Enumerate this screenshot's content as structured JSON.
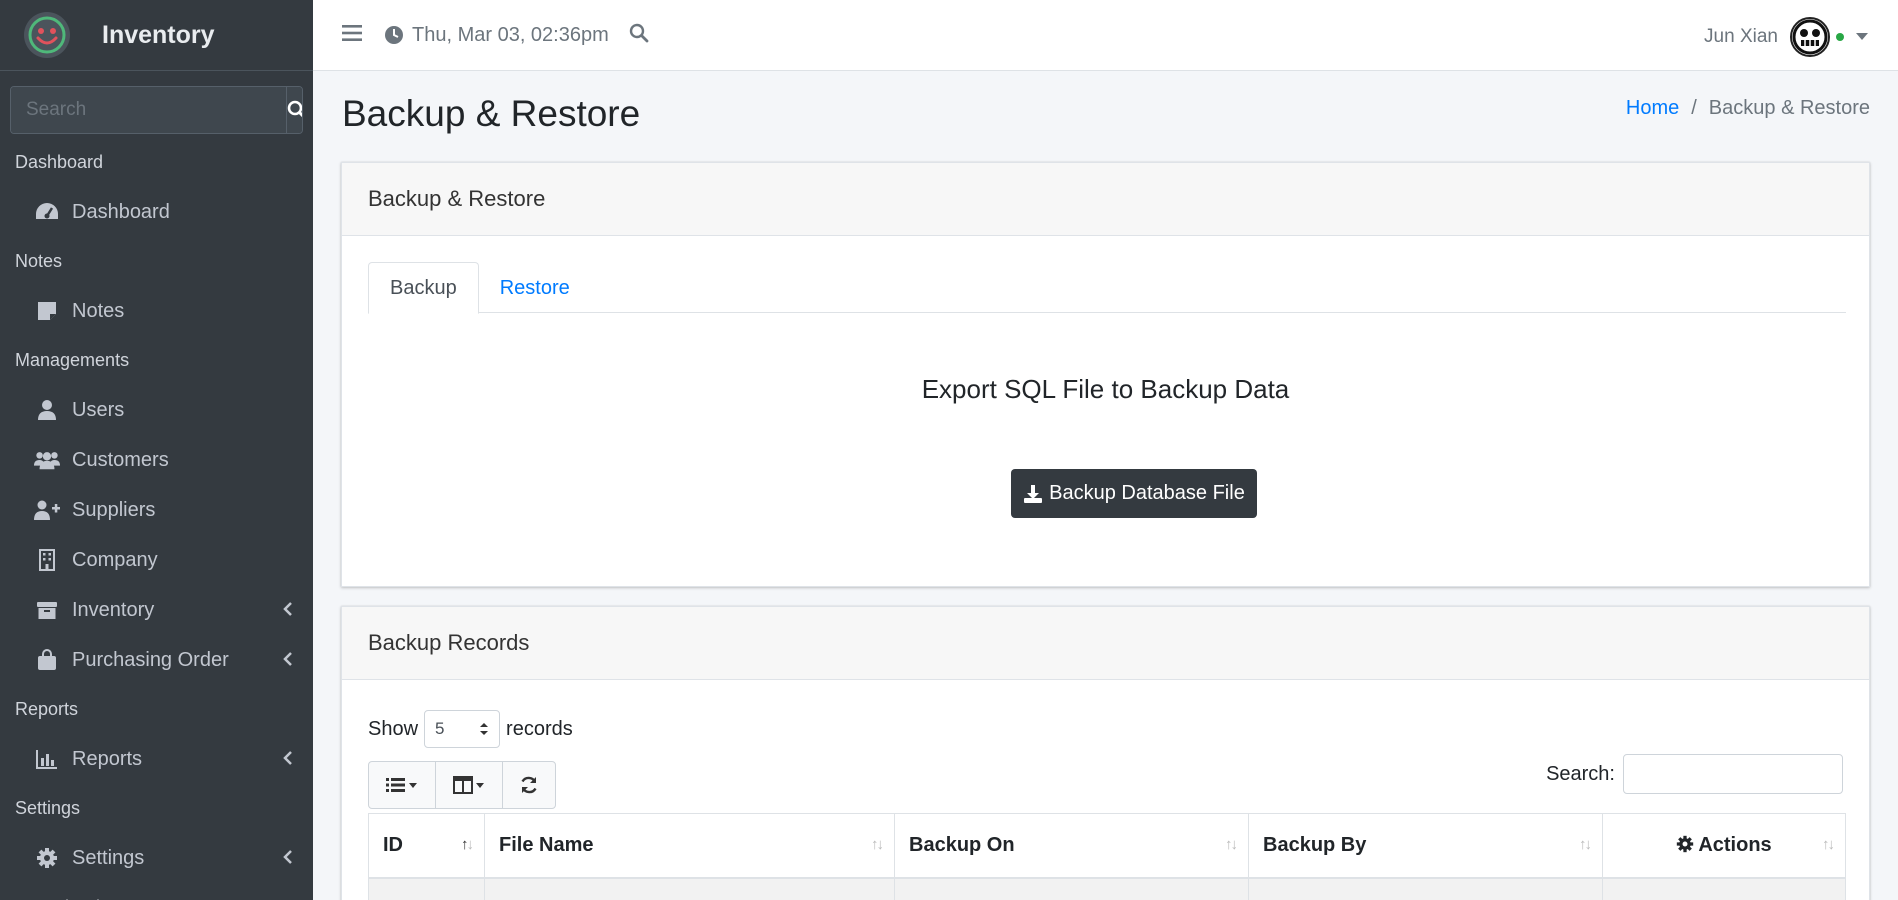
{
  "brand": {
    "name": "Inventory"
  },
  "sidebar": {
    "search_placeholder": "Search",
    "sections": [
      {
        "header": "Dashboard",
        "items": [
          {
            "label": "Dashboard",
            "icon": "tachometer-icon"
          }
        ]
      },
      {
        "header": "Notes",
        "items": [
          {
            "label": "Notes",
            "icon": "sticky-note-icon"
          }
        ]
      },
      {
        "header": "Managements",
        "items": [
          {
            "label": "Users",
            "icon": "user-icon"
          },
          {
            "label": "Customers",
            "icon": "users-icon"
          },
          {
            "label": "Suppliers",
            "icon": "user-plus-icon"
          },
          {
            "label": "Company",
            "icon": "building-icon"
          },
          {
            "label": "Inventory",
            "icon": "box-icon",
            "expandable": true
          },
          {
            "label": "Purchasing Order",
            "icon": "shopping-bag-icon",
            "expandable": true
          }
        ]
      },
      {
        "header": "Reports",
        "items": [
          {
            "label": "Reports",
            "icon": "chart-bar-icon",
            "expandable": true
          }
        ]
      },
      {
        "header": "Settings",
        "items": [
          {
            "label": "Settings",
            "icon": "gear-icon",
            "expandable": true
          }
        ]
      },
      {
        "header": "Recycle Bin",
        "items": []
      }
    ]
  },
  "topbar": {
    "datetime": "Thu, Mar 03, 02:36pm",
    "user_name": "Jun Xian"
  },
  "page": {
    "title": "Backup & Restore",
    "breadcrumb": {
      "home": "Home",
      "separator": "/",
      "current": "Backup & Restore"
    }
  },
  "backup_card": {
    "header": "Backup & Restore",
    "tabs": [
      "Backup",
      "Restore"
    ],
    "export_title": "Export SQL File to Backup Data",
    "button_label": "Backup Database File"
  },
  "records_card": {
    "header": "Backup Records",
    "show_label": "Show",
    "show_value": "5",
    "records_label": "records",
    "search_label": "Search:",
    "columns": [
      "ID",
      "File Name",
      "Backup On",
      "Backup By",
      "Actions"
    ]
  },
  "colors": {
    "sidebar_bg": "#343a40",
    "link": "#007bff",
    "primary_dark": "#343a40",
    "online": "#28a745"
  }
}
